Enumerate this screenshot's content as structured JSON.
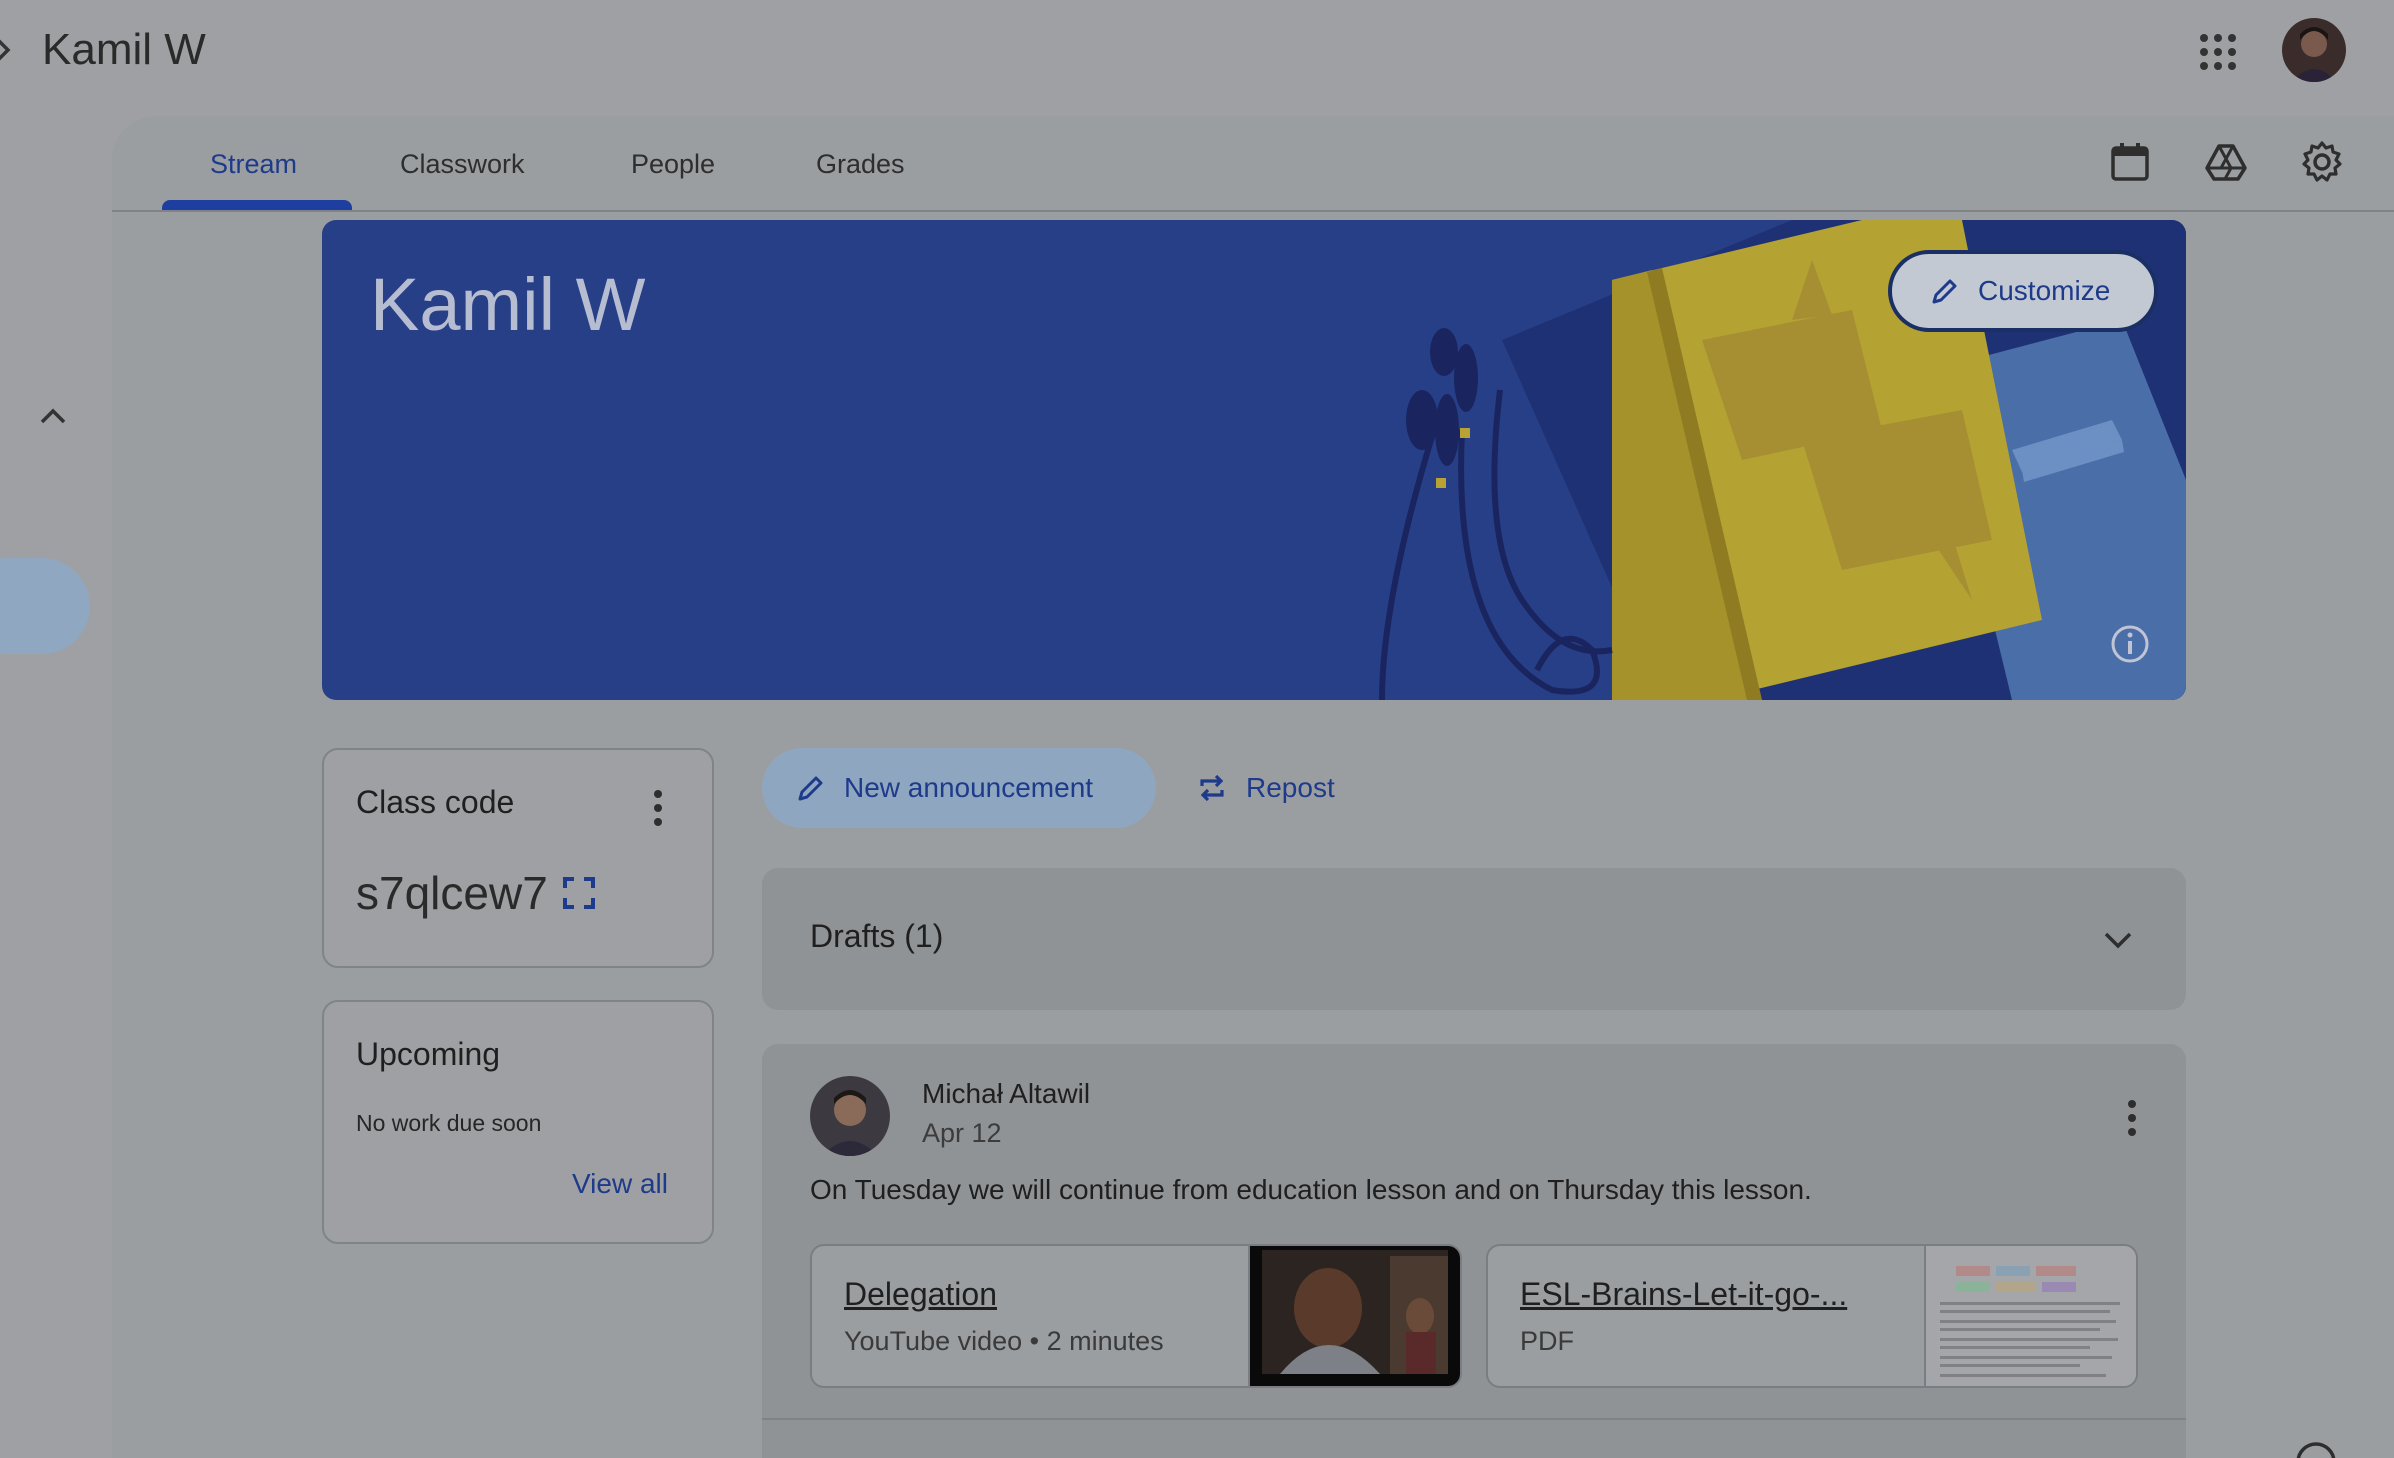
{
  "header": {
    "course_title": "Kamil W",
    "icons": [
      "chevron-right-icon",
      "google-apps-icon",
      "account-avatar"
    ]
  },
  "tabs": [
    {
      "label": "Stream",
      "active": true
    },
    {
      "label": "Classwork",
      "active": false
    },
    {
      "label": "People",
      "active": false
    },
    {
      "label": "Grades",
      "active": false
    }
  ],
  "header_actions": [
    "calendar-icon",
    "drive-icon",
    "settings-icon"
  ],
  "banner": {
    "title": "Kamil W",
    "customize_label": "Customize",
    "background_color": "#273f87"
  },
  "class_code": {
    "title": "Class code",
    "value": "s7qlcew7"
  },
  "upcoming": {
    "title": "Upcoming",
    "subtitle": "No work due soon",
    "link": "View all"
  },
  "actions": {
    "new_announcement": "New announcement",
    "repost": "Repost"
  },
  "drafts": {
    "label": "Drafts (1)"
  },
  "post": {
    "author": "Michał Altawil",
    "date": "Apr 12",
    "text": "On Tuesday we will continue from education lesson and on Thursday this lesson.",
    "attachments": [
      {
        "title": "Delegation",
        "subtitle": "YouTube video • 2 minutes"
      },
      {
        "title": "ESL-Brains-Let-it-go-...",
        "subtitle": "PDF"
      }
    ]
  },
  "colors": {
    "accent": "#1e3a8a",
    "overlay_bg": "#9ea0a3"
  }
}
